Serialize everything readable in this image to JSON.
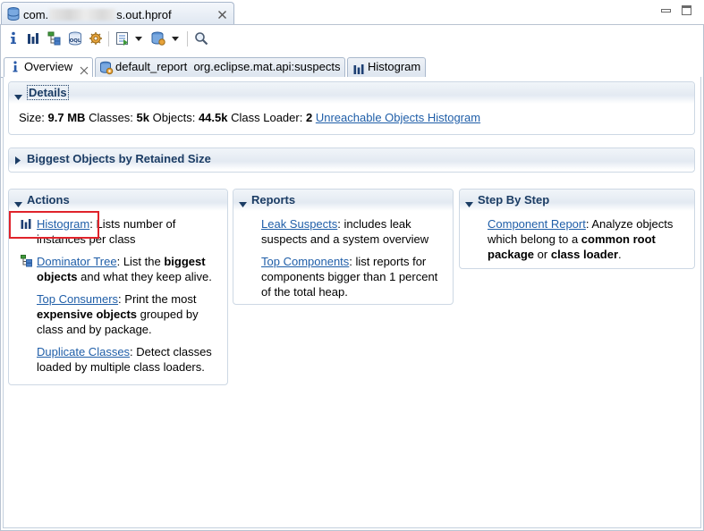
{
  "window": {
    "title_prefix": "com.",
    "title_suffix": "s.out.hprof"
  },
  "toolbar": {
    "icons": [
      "info-icon",
      "histogram-icon",
      "dominator-tree-icon",
      "oql-icon",
      "query-gear-icon",
      "run-report-icon",
      "dropdown-arrow-icon",
      "heap-dump-icon",
      "dropdown-arrow-icon",
      "search-icon"
    ]
  },
  "tabs": [
    {
      "label": "Overview"
    },
    {
      "label": "default_report  org.eclipse.mat.api:suspects"
    },
    {
      "label": "Histogram"
    }
  ],
  "details": {
    "title": "Details",
    "size_label": "Size:",
    "size": "9.7 MB",
    "classes_label": "Classes:",
    "classes": "5k",
    "objects_label": "Objects:",
    "objects": "44.5k",
    "loader_label": "Class Loader:",
    "loader": "2",
    "link": "Unreachable Objects Histogram"
  },
  "biggest": {
    "title": "Biggest Objects by Retained Size"
  },
  "actions": {
    "title": "Actions",
    "items": [
      {
        "link": "Histogram",
        "parts": [
          ": Lists number of instances per class"
        ]
      },
      {
        "link": "Dominator Tree",
        "parts": [
          ": List the ",
          "biggest objects",
          " and what they keep alive."
        ]
      },
      {
        "link": "Top Consumers",
        "parts": [
          ": Print the most ",
          "expensive objects",
          " grouped by class and by package."
        ]
      },
      {
        "link": "Duplicate Classes",
        "parts": [
          ": Detect classes loaded by multiple class loaders."
        ]
      }
    ]
  },
  "reports": {
    "title": "Reports",
    "items": [
      {
        "link": "Leak Suspects",
        "parts": [
          ": includes leak suspects and a system overview"
        ]
      },
      {
        "link": "Top Components",
        "parts": [
          ": list reports for components bigger than 1 percent of the total heap."
        ]
      }
    ]
  },
  "step": {
    "title": "Step By Step",
    "items": [
      {
        "link": "Component Report",
        "parts": [
          ": Analyze objects which belong to a ",
          "common root package",
          " or ",
          "class loader",
          "."
        ]
      }
    ]
  },
  "colors": {
    "header_text": "#1b3c64",
    "link": "#1f5ea8",
    "highlight": "#e0232b"
  }
}
